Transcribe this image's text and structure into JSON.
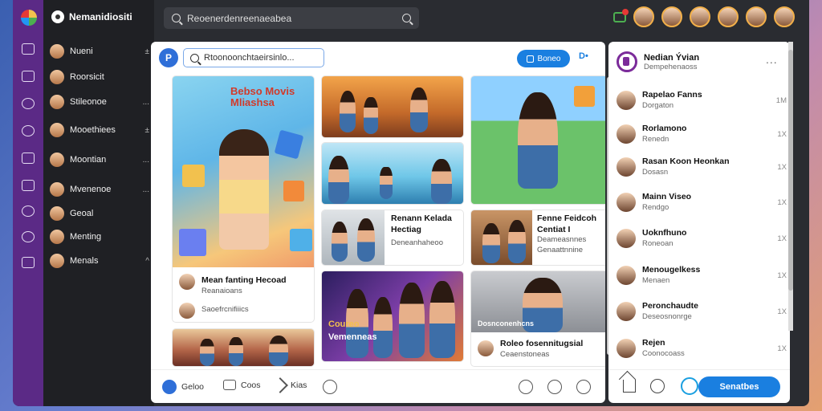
{
  "app": {
    "title": "Nemanidiositi"
  },
  "search": {
    "query": "Reoenerdenreenaeabea"
  },
  "channels": [
    {
      "label": "Nueni",
      "extra": "±"
    },
    {
      "label": "Roorsicit",
      "extra": ""
    },
    {
      "label": "Stileonoe",
      "extra": "..."
    },
    {
      "label": "Mooethiees",
      "extra": "±"
    },
    {
      "label": "Moontian",
      "extra": "..."
    },
    {
      "label": "Mvenenoe",
      "extra": "..."
    },
    {
      "label": "Geoal",
      "extra": ""
    },
    {
      "label": "Menting",
      "extra": ""
    },
    {
      "label": "Menals",
      "extra": "^"
    }
  ],
  "feed": {
    "search_placeholder": "Rtoonoonchtaeirsinlo...",
    "primary_button": "Boneo",
    "more_label": "D•",
    "cards": {
      "kids": {
        "overlay": "Bebso Movis Mliashsa",
        "title": "Mean fanting Hecoad",
        "subtitle": "Reanaioans",
        "line2": "Saoefrcnifiiics"
      },
      "cafe_family": {
        "title": "Renann Kelada",
        "line2": "Hectiag",
        "subtitle": "Deneanhaheoo"
      },
      "cafe_couple": {
        "title": "Fenne Feidcoh",
        "line2": "Centiat I",
        "subtitle": "Deameasnnes",
        "line3": "Genaattnnine"
      },
      "teens": {
        "overlay": "Coureo",
        "overlay2": "Vemenneas"
      },
      "portrait": {
        "overlay": "Dosnconenhcns",
        "title": "Roleo fosennitugsial",
        "subtitle": "Ceaenstoneas"
      }
    },
    "footer": {
      "a": "Geloo",
      "b": "Coos",
      "c": "Kias"
    }
  },
  "side": {
    "header": {
      "title": "Nedian Ývian",
      "subtitle": "Dempehenaoss"
    },
    "more": "...",
    "items": [
      {
        "title": "Rapelao Fanns",
        "subtitle": "Dorgaton",
        "x": "1M"
      },
      {
        "title": "Rorlamono",
        "subtitle": "Renedn",
        "x": "1X"
      },
      {
        "title": "Rasan Koon Heonkan",
        "subtitle": "Dosasn",
        "x": "1X"
      },
      {
        "title": "Mainn Viseo",
        "subtitle": "Rendgo",
        "x": "1X"
      },
      {
        "title": "Uoknfhuno",
        "subtitle": "Roneoan",
        "x": "1X"
      },
      {
        "title": "Menougelkess",
        "subtitle": "Menaen",
        "x": "1X"
      },
      {
        "title": "Peronchaudte",
        "subtitle": "Deseosnonrge",
        "x": "1X"
      },
      {
        "title": "Rejen",
        "subtitle": "Coonocoass",
        "x": "1X"
      }
    ],
    "submit": "Senatbes"
  },
  "colors": {
    "accent": "#1a7fe0",
    "rail": "#5b2a86",
    "sidebar": "#1f2024"
  }
}
